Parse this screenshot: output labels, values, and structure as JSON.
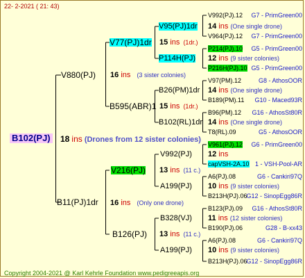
{
  "header": "22-  2-2021  ( 21: 43)",
  "footer": "Copyright 2004-2021 @ Karl Kehrle Foundation    www.pedigreeapis.org",
  "root": {
    "label": "B102(PJ)",
    "ins": "18",
    "unit": "ins",
    "note": "(Drones from 12 sister colonies)"
  },
  "gen1": [
    {
      "label": "V880(PJ)",
      "ins": "16",
      "unit": "ins",
      "note": "(3 sister colonies)"
    },
    {
      "label": "B11(PJ)1dr",
      "ins": "16",
      "unit": "ins",
      "note": "(Only one drone)"
    }
  ],
  "gen2": [
    {
      "label": "V77(PJ)1dr",
      "ins": "15",
      "unit": "ins",
      "note": "(1dr.)"
    },
    {
      "label": "B595(ABR)1",
      "ins": "15",
      "unit": "ins",
      "note": "(1dr.)"
    },
    {
      "label": "V216(PJ)",
      "ins": "13",
      "unit": "ins",
      "note": "(11 c.)"
    },
    {
      "label": "B126(PJ)",
      "ins": "13",
      "unit": "ins",
      "note": "(11 c.)"
    }
  ],
  "gen3": [
    {
      "label": "V95(PJ)1dr",
      "ins": "14",
      "unit": "ins",
      "note": "(One single drone)"
    },
    {
      "label": "P114H(PJ)",
      "ins": "12",
      "unit": "ins",
      "note": "(9 sister colonies)"
    },
    {
      "label": "B26(PM)1dr",
      "ins": "14",
      "unit": "ins",
      "note": "(One single drone)"
    },
    {
      "label": "B102(RL)1dr",
      "ins": "14",
      "unit": "ins",
      "note": "(One single drone)"
    },
    {
      "label": "V992(PJ)",
      "ins": "12",
      "unit": "ins",
      "note": ""
    },
    {
      "label": "A199(PJ)",
      "ins": "10",
      "unit": "ins",
      "note": "(9 sister colonies)"
    },
    {
      "label": "B328(VJ)",
      "ins": "11",
      "unit": "ins",
      "note": "(12 sister colonies)"
    },
    {
      "label": "A199(PJ)",
      "ins": "10",
      "unit": "ins",
      "note": "(9 sister colonies)"
    }
  ],
  "gen4": [
    {
      "label": "V992(PJ).12",
      "code": "G7 - PrimGreen00"
    },
    {
      "label": "V964(PJ).12",
      "code": "G7 - PrimGreen00"
    },
    {
      "label": "P214(PJ).10",
      "code": "G5 - PrimGreen00"
    },
    {
      "label": "P216H(PJ).10",
      "code": "G5 - PrimGreen00"
    },
    {
      "label": "V97(PM).12",
      "code": "G8 - AthosOOR"
    },
    {
      "label": "B189(PM).11",
      "code": "G10 - Maced93R"
    },
    {
      "label": "B96(PM).12",
      "code": "G16 - AthosSt80R"
    },
    {
      "label": "T8(RL).09",
      "code": "G5 - AthosOOR"
    },
    {
      "label": "V961(PJ).12",
      "code": "G6 - PrimGreen00"
    },
    {
      "label": "capVSH-2A.10",
      "code": "1 - VSH-Pool-AR"
    },
    {
      "label": "A6(PJ).08",
      "code": "G6 - Cankiri97Q"
    },
    {
      "label": "B213H(PJ).06",
      "code": "G12 - SinopEgg86R"
    },
    {
      "label": "B123(PJ).09",
      "code": "G16 - AthosSt80R"
    },
    {
      "label": "B190(PJ).06",
      "code": "G28 - B-xx43"
    },
    {
      "label": "A6(PJ).08",
      "code": "G6 - Cankiri97Q"
    },
    {
      "label": "B213H(PJ).06",
      "code": "G12 - SinopEgg86R"
    }
  ],
  "colors": {
    "red": "#cc0000",
    "blue": "#1a1ac8",
    "cyan": "#00ffff",
    "green": "#00e000",
    "pink": "#f7c7f7"
  }
}
